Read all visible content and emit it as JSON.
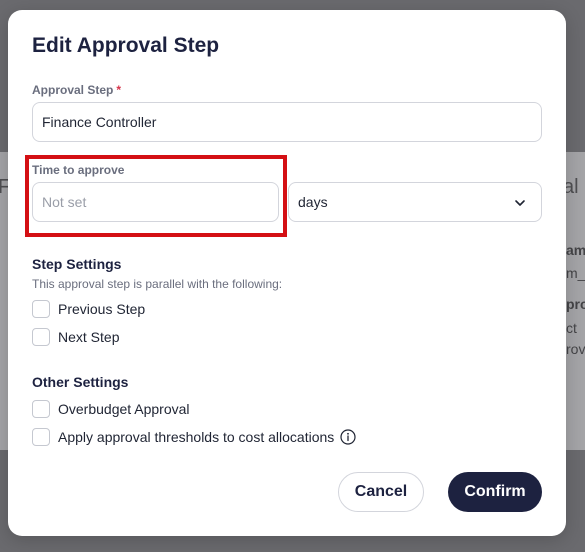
{
  "background": {
    "fragments": [
      {
        "id": "frag-left",
        "text": "F"
      },
      {
        "id": "frag-right-top",
        "text": "al"
      },
      {
        "id": "frag-am",
        "text": "am"
      },
      {
        "id": "frag-m",
        "text": "m_"
      },
      {
        "id": "frag-pro",
        "text": "pro"
      },
      {
        "id": "frag-ct",
        "text": "ct"
      },
      {
        "id": "frag-rov",
        "text": "rov"
      }
    ]
  },
  "modal": {
    "title": "Edit Approval Step",
    "approval_step": {
      "label": "Approval Step",
      "required_mark": "*",
      "value": "Finance Controller"
    },
    "time_to_approve": {
      "label": "Time to approve",
      "placeholder": "Not set",
      "unit": "days"
    },
    "step_settings": {
      "title": "Step Settings",
      "hint": "This approval step is parallel with the following:",
      "options": [
        {
          "label": "Previous Step",
          "checked": false
        },
        {
          "label": "Next Step",
          "checked": false
        }
      ]
    },
    "other_settings": {
      "title": "Other Settings",
      "options": [
        {
          "label": "Overbudget Approval",
          "checked": false
        },
        {
          "label": "Apply approval thresholds to cost allocations",
          "checked": false
        }
      ]
    },
    "buttons": {
      "cancel": "Cancel",
      "confirm": "Confirm"
    },
    "colors": {
      "primary": "#1d2240",
      "highlight": "#d40f14",
      "required": "#d6344a"
    }
  }
}
